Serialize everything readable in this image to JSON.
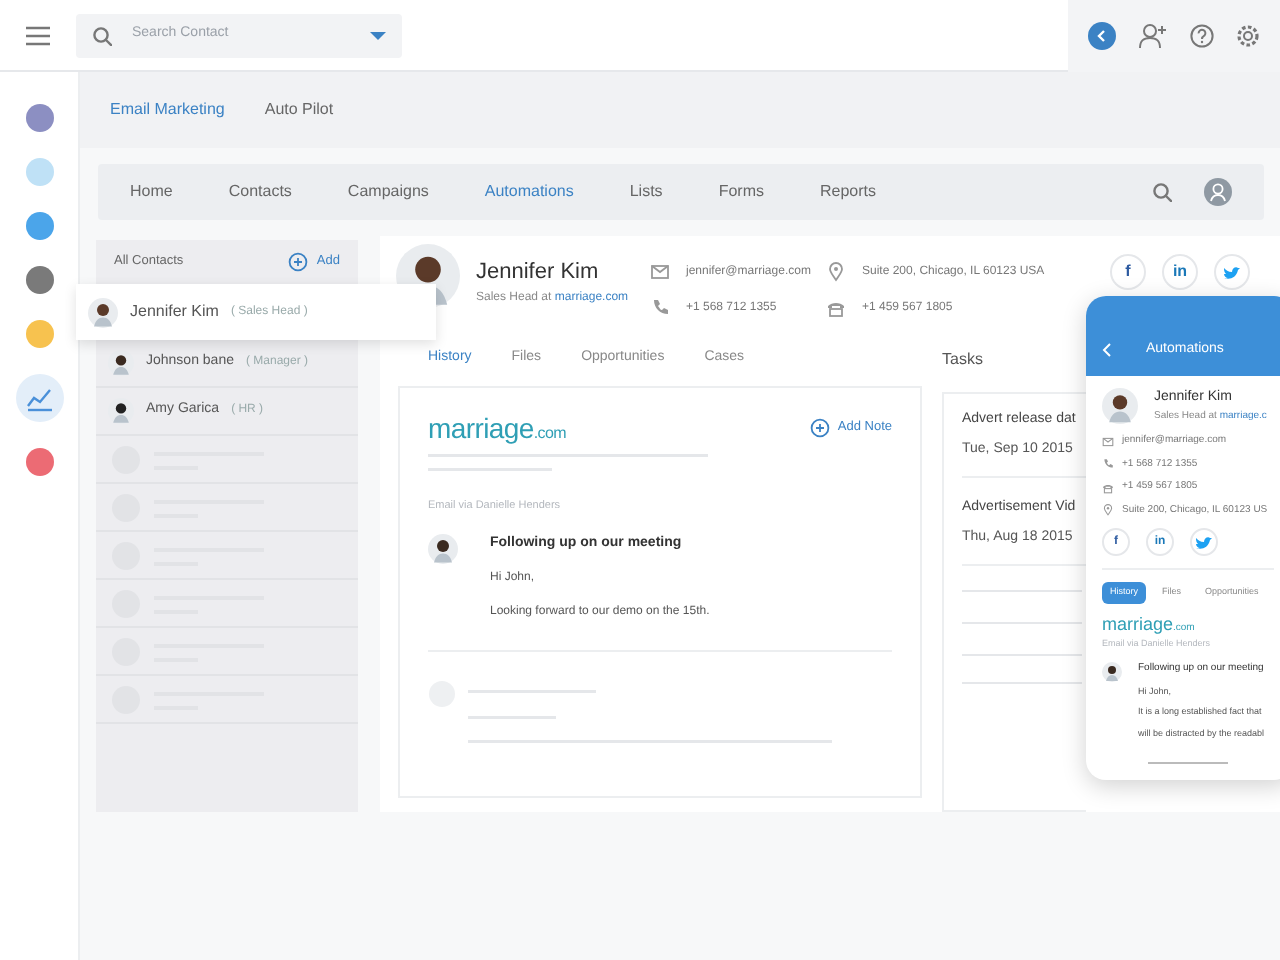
{
  "topbar": {
    "search": {
      "placeholder": "Search Contact"
    }
  },
  "rail": [
    {
      "kind": "dot",
      "color": "#8c8fc2",
      "selected": false
    },
    {
      "kind": "dot",
      "color": "#bfe1f6",
      "selected": false
    },
    {
      "kind": "dot",
      "color": "#4ba5ea",
      "selected": false
    },
    {
      "kind": "dot",
      "color": "#7a7a7a",
      "selected": false
    },
    {
      "kind": "dot",
      "color": "#f7c24f",
      "selected": false
    },
    {
      "kind": "chart",
      "color": "#4a90d9",
      "selected": true
    },
    {
      "kind": "dot",
      "color": "#ec6b74",
      "selected": false
    }
  ],
  "app_tabs": [
    {
      "label": "Email Marketing",
      "selected": true
    },
    {
      "label": "Auto Pilot",
      "selected": false
    }
  ],
  "nav": [
    {
      "label": "Home",
      "selected": false
    },
    {
      "label": "Contacts",
      "selected": false
    },
    {
      "label": "Campaigns",
      "selected": false
    },
    {
      "label": "Automations",
      "selected": true
    },
    {
      "label": "Lists",
      "selected": false
    },
    {
      "label": "Forms",
      "selected": false
    },
    {
      "label": "Reports",
      "selected": false
    }
  ],
  "contacts": {
    "header": "All Contacts",
    "add": "Add",
    "items": [
      {
        "name": "Jennifer Kim",
        "role": "( Sales Head )",
        "selected": true
      },
      {
        "name": "Johnson bane",
        "role": "( Manager )",
        "selected": false
      },
      {
        "name": "Amy Garica",
        "role": "( HR )",
        "selected": false
      }
    ]
  },
  "profile": {
    "name": "Jennifer Kim",
    "title": "Sales Head at",
    "company": "marriage.com",
    "email": "jennifer@marriage.com",
    "phone": "+1 568 712 1355",
    "address": "Suite 200, Chicago, IL 60123 USA",
    "landline": "+1 459 567 1805"
  },
  "social": [
    {
      "kind": "facebook",
      "label": "f"
    },
    {
      "kind": "linkedin",
      "label": "in"
    },
    {
      "kind": "twitter"
    }
  ],
  "detail_tabs": [
    {
      "label": "History",
      "selected": true
    },
    {
      "label": "Files",
      "selected": false
    },
    {
      "label": "Opportunities",
      "selected": false
    },
    {
      "label": "Cases",
      "selected": false
    }
  ],
  "note": {
    "logo": "marriage",
    "logo_suffix": ".com",
    "add_note": "Add Note",
    "via": "Email via Danielle Henders",
    "subject": "Following up on our meeting",
    "greeting": "Hi John,",
    "body": "Looking forward to our demo on the 15th."
  },
  "tasks": {
    "title": "Tasks",
    "items": [
      {
        "title": "Advert release dat",
        "date": "Tue, Sep 10 2015"
      },
      {
        "title": "Advertisement Vid",
        "date": "Thu, Aug 18 2015"
      }
    ]
  },
  "phone": {
    "title": "Automations",
    "name": "Jennifer Kim",
    "job": "Sales Head at",
    "company": "marriage.c",
    "email": "jennifer@marriage.com",
    "phone": "+1 568 712 1355",
    "landline": "+1 459 567 1805",
    "address": "Suite 200, Chicago, IL 60123 US",
    "social": [
      {
        "kind": "facebook",
        "label": "f"
      },
      {
        "kind": "linkedin",
        "label": "in"
      },
      {
        "kind": "twitter"
      }
    ],
    "tabs": [
      {
        "label": "History",
        "selected": true
      },
      {
        "label": "Files",
        "selected": false
      },
      {
        "label": "Opportunities",
        "selected": false
      }
    ],
    "logo": "marriage",
    "logo_suffix": ".com",
    "via": "Email via Danielle Henders",
    "subject": "Following up on our meeting",
    "greeting": "Hi John,",
    "lines": [
      "It is a long established fact that",
      "will be distracted by the readabl"
    ]
  }
}
